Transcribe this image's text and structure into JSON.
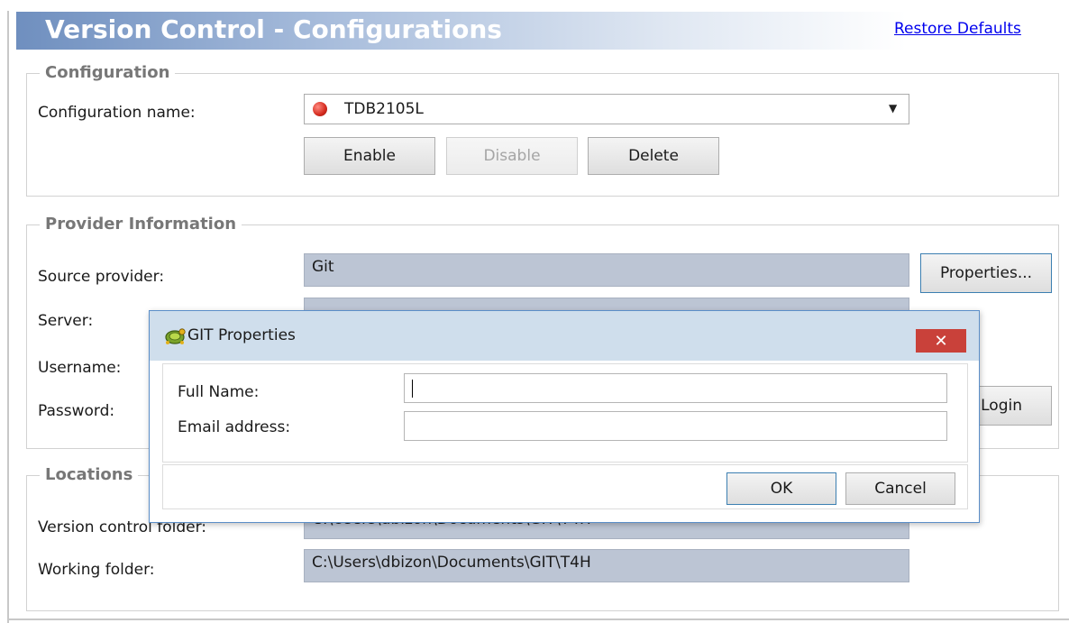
{
  "header": {
    "title": "Version Control - Configurations",
    "restore_link": "Restore Defaults"
  },
  "configuration": {
    "legend": "Configuration",
    "name_label": "Configuration name:",
    "selected": "TDB2105L",
    "status_color": "#d42a1e",
    "buttons": {
      "enable": "Enable",
      "disable": "Disable",
      "delete": "Delete"
    }
  },
  "provider": {
    "legend": "Provider Information",
    "source_label": "Source provider:",
    "source_value": "Git",
    "properties_button": "Properties...",
    "server_label": "Server:",
    "username_label": "Username:",
    "password_label": "Password:",
    "login_button": "Login"
  },
  "locations": {
    "legend": "Locations",
    "vc_folder_label": "Version control folder:",
    "vc_folder_value": "C:\\Users\\dbizon\\Documents\\GIT\\T4H",
    "working_label": "Working folder:",
    "working_value": "C:\\Users\\dbizon\\Documents\\GIT\\T4H"
  },
  "dialog": {
    "title": "GIT Properties",
    "icon": "tortoise-icon",
    "full_name_label": "Full Name:",
    "full_name_value": "",
    "email_label": "Email address:",
    "email_value": "",
    "ok": "OK",
    "cancel": "Cancel",
    "close_glyph": "✕"
  }
}
